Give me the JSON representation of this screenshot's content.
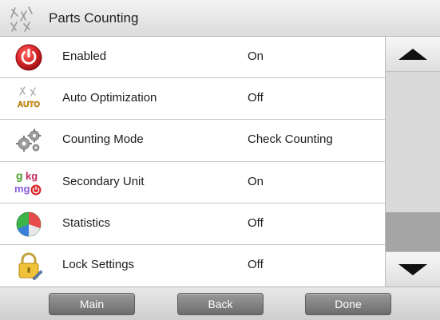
{
  "header": {
    "title": "Parts Counting",
    "icon": "parts-counting-icon"
  },
  "settings": [
    {
      "label": "Enabled",
      "value": "On",
      "icon": "power-icon"
    },
    {
      "label": "Auto Optimization",
      "value": "Off",
      "icon": "auto-optimization-icon"
    },
    {
      "label": "Counting Mode",
      "value": "Check Counting",
      "icon": "gears-icon"
    },
    {
      "label": "Secondary Unit",
      "value": "On",
      "icon": "units-icon"
    },
    {
      "label": "Statistics",
      "value": "Off",
      "icon": "pie-chart-icon"
    },
    {
      "label": "Lock Settings",
      "value": "Off",
      "icon": "lock-icon"
    }
  ],
  "units_icon_text": {
    "g": "g",
    "kg": "kg",
    "mg": "mg"
  },
  "auto_icon_text": "AUTO",
  "scrollbar": {
    "up_icon": "arrow-up-icon",
    "down_icon": "arrow-down-icon",
    "position": 1.0
  },
  "footer": {
    "main_label": "Main",
    "back_label": "Back",
    "done_label": "Done"
  },
  "colors": {
    "accent_red": "#d8262b",
    "button_gray": "#7f7f7f",
    "thumb_gray": "#a5a5a5"
  }
}
